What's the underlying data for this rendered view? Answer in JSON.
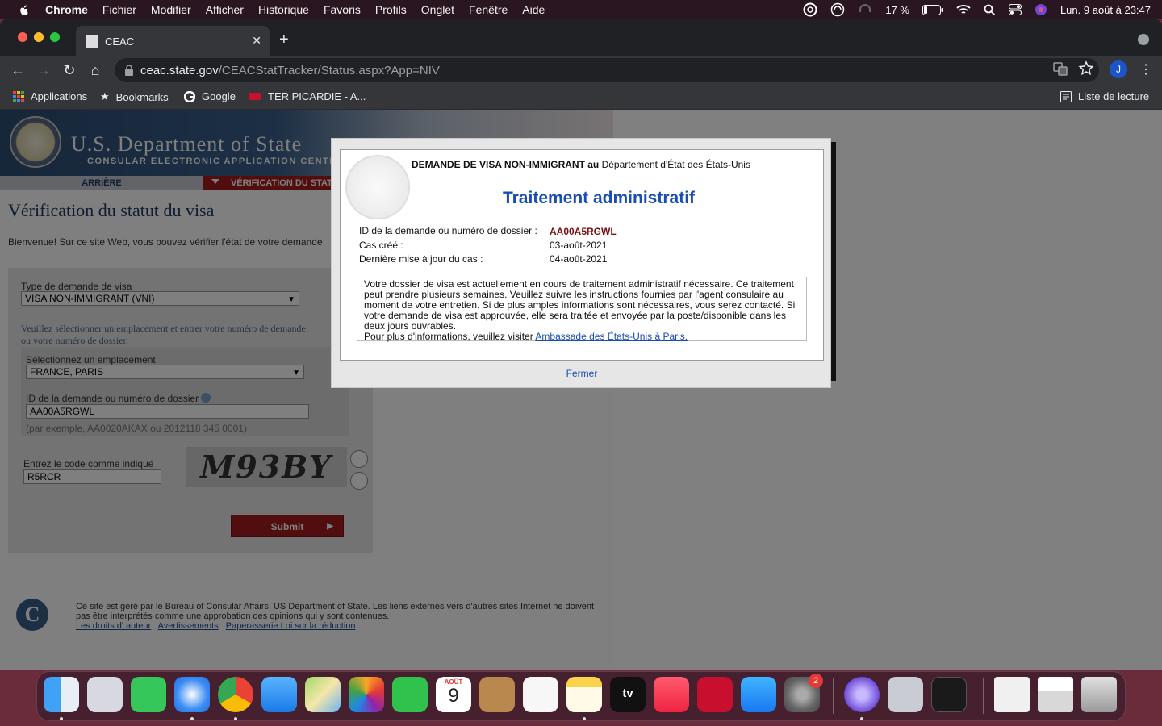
{
  "menubar": {
    "app": "Chrome",
    "items": [
      "Fichier",
      "Modifier",
      "Afficher",
      "Historique",
      "Favoris",
      "Profils",
      "Onglet",
      "Fenêtre",
      "Aide"
    ],
    "battery": "17 %",
    "datetime": "Lun. 9 août à  23:47"
  },
  "browser": {
    "tab_title": "CEAC",
    "url_host": "ceac.state.gov",
    "url_path": "/CEACStatTracker/Status.aspx?App=NIV",
    "avatar_letter": "J",
    "bookmarks": [
      "Applications",
      "Bookmarks",
      "Google",
      "TER PICARDIE - A..."
    ],
    "reading_list": "Liste de lecture"
  },
  "site": {
    "dept_title": "U.S. Department of State",
    "dept_subtitle": "CONSULAR ELECTRONIC APPLICATION CENTER",
    "nav_back": "ARRIÈRE",
    "nav_current": "VÉRIFICATION DU STATUT",
    "page_title": "Vérification du statut du visa",
    "welcome": "Bienvenue! Sur ce site Web, vous pouvez vérifier l'état de votre demande",
    "form": {
      "visa_type_label": "Type de demande de visa",
      "visa_type_value": "VISA NON-IMMIGRANT (VNI)",
      "instruction": "Veuillez sélectionner un emplacement et entrer votre numéro de demande ou votre numéro de dossier.",
      "location_label": "Sélectionnez un emplacement",
      "location_value": "FRANCE, PARIS",
      "app_id_label": "ID de la demande ou numéro de dossier",
      "app_id_value": "AA00A5RGWL",
      "app_id_example": "(par exemple, AA0020AKAX ou 2012118 345 0001)",
      "captcha_label": "Entrez le code comme indiqué",
      "captcha_input": "R5RCR",
      "captcha_image_text": "M93BY",
      "submit": "Submit"
    },
    "footer": {
      "text": "Ce site est géré par le Bureau of Consular Affairs, US Department of State. Les liens externes vers d'autres sites Internet ne doivent pas être interprétés comme une approbation des opinions qui y sont contenues.",
      "links": [
        "Les droits d' auteur",
        "Avertissements",
        "Paperasserie Loi sur la réduction"
      ]
    }
  },
  "modal": {
    "head_bold": "DEMANDE DE VISA NON-IMMIGRANT au",
    "head_rest": "Département d'État des États-Unis",
    "status": "Traitement administratif",
    "rows": [
      {
        "label": "ID de la demande ou numéro de dossier :",
        "value": "AA00A5RGWL"
      },
      {
        "label": "Cas créé :",
        "value": "03-août-2021"
      },
      {
        "label": "Dernière mise à jour du cas :",
        "value": "04-août-2021"
      }
    ],
    "message": "Votre dossier de visa est actuellement en cours de traitement administratif nécessaire. Ce traitement peut prendre plusieurs semaines. Veuillez suivre les instructions fournies par l'agent consulaire au moment de votre entretien. Si de plus amples informations sont nécessaires, vous serez contacté. Si votre demande de visa est approuvée, elle sera traitée et envoyée par la poste/disponible dans les deux jours ouvrables.",
    "more_info": "Pour plus d'informations, veuillez visiter",
    "link": "Ambassade des États-Unis à Paris.",
    "close": "Fermer"
  },
  "dock": {
    "calendar_month": "AOÛT",
    "calendar_day": "9",
    "tv_label": "tv",
    "settings_badge": "2"
  }
}
